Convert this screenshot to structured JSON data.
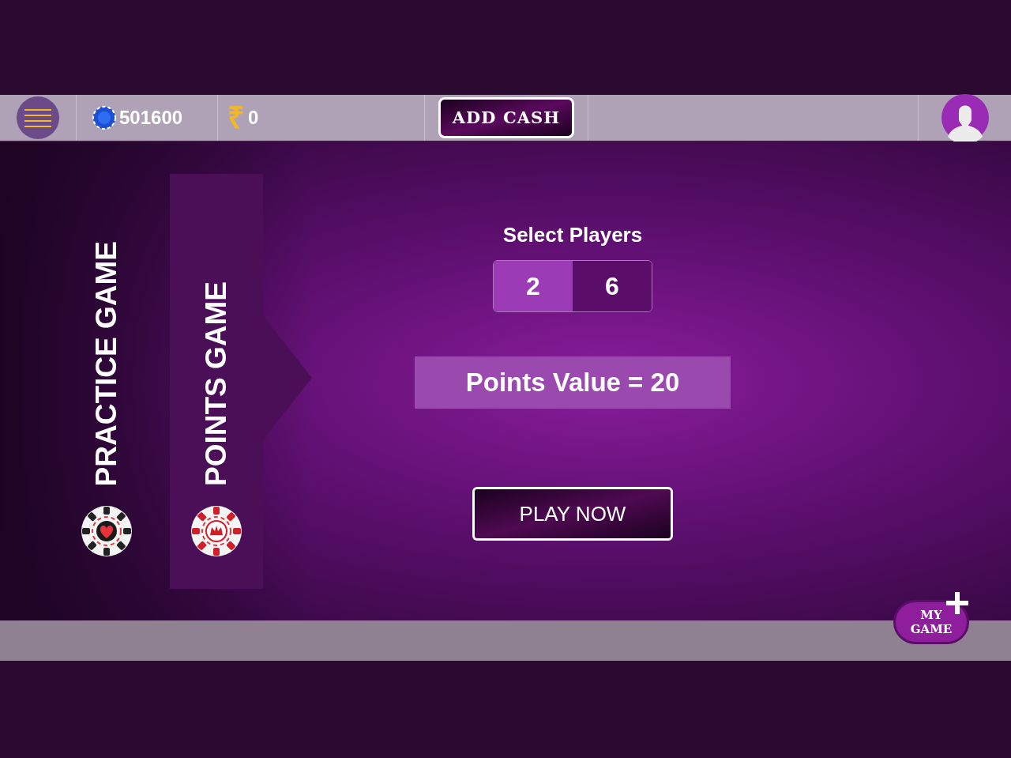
{
  "header": {
    "coins": "501600",
    "currency_symbol": "₹",
    "cash": "0",
    "add_cash_button": "ADD CASH"
  },
  "game_modes": [
    {
      "label": "PRACTICE GAME",
      "selected": false
    },
    {
      "label": "POINTS GAME",
      "selected": true
    }
  ],
  "select_players": {
    "title": "Select Players",
    "options": [
      {
        "label": "2",
        "selected": true
      },
      {
        "label": "6",
        "selected": false
      }
    ]
  },
  "points_value": "Points Value = 20",
  "play_button": "PLAY NOW",
  "my_game_button": "MY GAME"
}
